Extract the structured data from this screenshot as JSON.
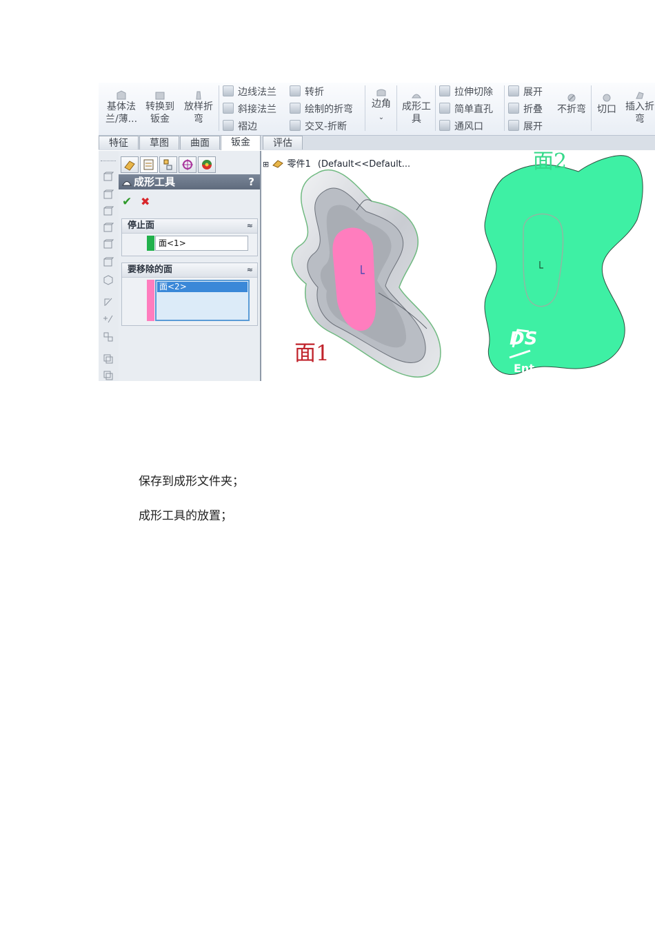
{
  "ribbon": {
    "large": [
      {
        "l1": "基体法",
        "l2": "兰/薄..."
      },
      {
        "l1": "转换到",
        "l2": "钣金"
      },
      {
        "l1": "放样折",
        "l2": "弯"
      }
    ],
    "col1": [
      "边线法兰",
      "斜接法兰",
      "褶边"
    ],
    "col2": [
      "转折",
      "绘制的折弯",
      "交叉-折断"
    ],
    "corner": {
      "label": "边角",
      "arrow": "⌄"
    },
    "forming": {
      "l1": "成形工",
      "l2": "具"
    },
    "col3": [
      "拉伸切除",
      "简单直孔",
      "通风口"
    ],
    "col4": [
      "展开",
      "折叠",
      "展开"
    ],
    "no_bend": "不折弯",
    "rip": "切口",
    "insert_bend": {
      "l1": "插入折",
      "l2": "弯"
    }
  },
  "tabs": [
    {
      "label": "特征"
    },
    {
      "label": "草图"
    },
    {
      "label": "曲面"
    },
    {
      "label": "钣金"
    },
    {
      "label": "评估"
    }
  ],
  "pm": {
    "title": "成形工具",
    "help": "?",
    "ok_glyph": "✔",
    "cancel_glyph": "✖",
    "stop_face": {
      "header": "停止面",
      "collapse": "≈",
      "item": "面<1>"
    },
    "remove_faces": {
      "header": "要移除的面",
      "collapse": "≈",
      "item": "面<2>"
    }
  },
  "tree": {
    "expand": "⊞",
    "part": "零件1",
    "config": "(Default<<Default..."
  },
  "view": {
    "face1_label": "面1",
    "face2_label": "面2",
    "logo": "DS",
    "logo_sub": "Ent"
  },
  "colors": {
    "stop_face": "#22b14c",
    "remove_face": "#ff7dbe",
    "face2": "#3ef0a4",
    "face1_label": "#c0232b",
    "face2_label": "#36d98a"
  },
  "doc": {
    "line1": "保存到成形文件夹；",
    "line2": "成形工具的放置；"
  }
}
